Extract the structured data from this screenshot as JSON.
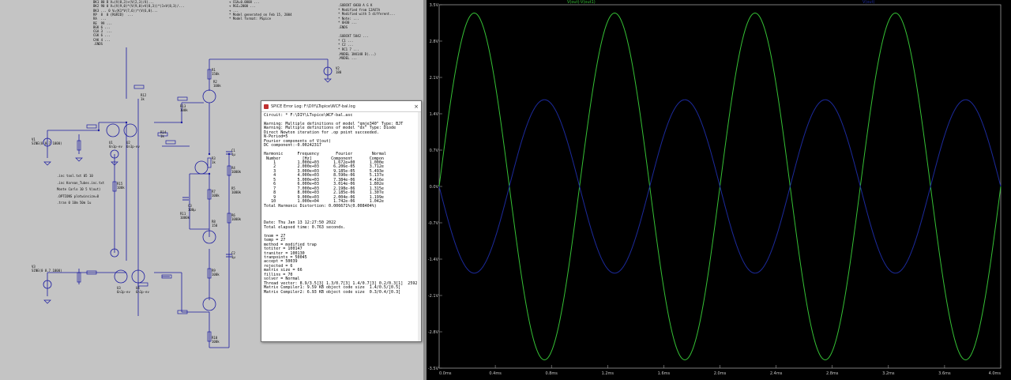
{
  "schematic": {
    "model_lines": [
      "BK1 80 B V=(V(8,3)+(V(2,3)/4)...",
      "BK2 90 0 V=(V(9,0)*(V(9,0)+V(8,3))*(1+V(8,3)/...",
      "BK3 ... 0 V=(K1*V(7,6))*(V(6,0)... ",
      "RP  8  0 {RGRID}  ...",
      "RA  ... ",
      "RE  99 ...",
      "BGK 6 ... ",
      "CGA 3  ... ",
      "CGK 6 ...",
      "CAK 4 ...",
      ".ENDS"
    ],
    "dir_lines": [
      ".inc tool.txt 05 10",
      ".inc Korean_Tubes.inc.txt",
      "Monte Carlo 10 5 V(out)",
      ".OPTIONS plotwinsize=0",
      ".tran 0 10m 50m 1u"
    ],
    "right_lines": [
      ".SUBCKT 6H30 A G K",
      "* Modified from 12AX7A",
      "* Modified with 5 different...",
      "* Note: ...",
      "* 6H30 ...",
      ".ENDS",
      "",
      ".SUBCKT 5842 ...",
      "* C1 ...",
      "* C2 ...",
      "* RC1 7 ...",
      ".MODEL 1N4148 D(...)",
      ".MODEL ..."
    ],
    "top_lines": [
      "+ CGA=0.0008 ...",
      "+ RGI=2000 ...",
      "+ ...",
      "* Model generated on Feb 15, 2004",
      "* Model format: PSpice"
    ],
    "components": [
      {
        "ref": "V2",
        "val": "180"
      },
      {
        "ref": "R1",
        "val": "150k"
      },
      {
        "ref": "R2",
        "val": "100k"
      },
      {
        "ref": "R3",
        "val": "1k"
      },
      {
        "ref": "R4",
        "val": "1000k"
      },
      {
        "ref": "R5",
        "val": "1000k"
      },
      {
        "ref": "R6",
        "val": "1000k"
      },
      {
        "ref": "R7",
        "val": "100k"
      },
      {
        "ref": "R8",
        "val": "150"
      },
      {
        "ref": "R9",
        "val": "100k"
      },
      {
        "ref": "R10",
        "val": "100k"
      },
      {
        "ref": "R11",
        "val": "1000k"
      },
      {
        "ref": "R12",
        "val": "1k"
      },
      {
        "ref": "R13",
        "val": "100k"
      },
      {
        "ref": "R14",
        "val": "1k"
      },
      {
        "ref": "R15",
        "val": "100k"
      },
      {
        "ref": "C1",
        "val": "1µ"
      },
      {
        "ref": "C2",
        "val": "1µ"
      },
      {
        "ref": "C3",
        "val": "100µ"
      },
      {
        "ref": "U1",
        "val": "6n1p-ev"
      },
      {
        "ref": "U2",
        "val": "6n1p-ev"
      },
      {
        "ref": "U3",
        "val": "6n1p-ev"
      },
      {
        "ref": "U4",
        "val": "6n1p-ev"
      },
      {
        "ref": "V1",
        "val": "SINE(0 0.7 1000)"
      },
      {
        "ref": "V3",
        "val": "SINE(0 0.7 1000)"
      }
    ]
  },
  "error_log": {
    "title": "SPICE Error Log: F:\\DIY\\LTspice\\WCF-bal.log",
    "close": "×",
    "lines": [
      "Circuit: * F:\\DIY\\LTspice\\WCF-bal.asc",
      "",
      "Warning: Multiple definitions of model \"qmje340\" Type: BJT",
      "Warning: Multiple definitions of model \"dx\" Type: Diode",
      "Direct Newton iteration for .op point succeeded.",
      "N-Period=5",
      "Fourier components of V(out)",
      "DC component:-0.00242317",
      "",
      "Harmonic      Frequency       Fourier        Normal",
      " Number         [Hz]        Component       Compon",
      "    1         1.000e+03      1.672e+00      1.000e",
      "    2         2.000e+03      6.206e-05      3.712e",
      "    3         3.000e+03      9.185e-05      5.493e",
      "    4         4.000e+03      8.590e-06      5.137e",
      "    5         5.000e+03      7.384e-06      4.416e",
      "    6         6.000e+03      3.014e-06      1.802e",
      "    7         7.000e+03      2.198e-06      1.315e",
      "    8         8.000e+03      2.185e-06      1.307e",
      "    9         9.000e+03      2.004e-06      1.199e",
      "   10         1.000e+04      1.742e-06      1.042e",
      "Total Harmonic Distortion: 0.006671%(0.008404%)",
      "",
      "",
      "",
      "Date: Thu Jan 13 12:27:50 2022",
      "Total elapsed time: 0.763 seconds.",
      "",
      "tnom = 27",
      "temp = 27",
      "method = modified trap",
      "totiter = 100147",
      "traniter = 100130",
      "tranpoints = 50045",
      "accept = 50039",
      "rejected = 6",
      "matrix size = 66",
      "fillins = 70",
      "solver = Normal",
      "Thread vector: 8.9/3.5[3] 1.3/0.7[3] 1.4/0.7[3] 0.2/0.3[1]  2592",
      "Matrix Compiler1: 9.59 KB object code size  1.4/0.5/[0.5]",
      "Matrix Compiler2: 6.93 KB object code size  0.3/0.4/[0.3]"
    ]
  },
  "plot": {
    "trace_green_label": "V(out)-V(out1)",
    "trace_blue_label": "V(out)",
    "colors": {
      "green": "#35c035",
      "blue": "#1c2a9c",
      "grid": "#9a9a9a",
      "bg": "#000000"
    },
    "y_ticks": [
      "3.5V",
      "2.8V",
      "2.1V",
      "1.4V",
      "0.7V",
      "0.0V",
      "-0.7V",
      "-1.4V",
      "-2.1V",
      "-2.8V",
      "-3.5V"
    ],
    "x_ticks": [
      "0.0ms",
      "0.4ms",
      "0.8ms",
      "1.2ms",
      "1.6ms",
      "2.0ms",
      "2.4ms",
      "2.8ms",
      "3.2ms",
      "3.6ms",
      "4.0ms"
    ],
    "series": [
      {
        "name": "V(out)-V(out1)",
        "amplitude_v": 3.34,
        "freq_hz": 1000,
        "phase": "sin"
      },
      {
        "name": "V(out)",
        "amplitude_v": 1.67,
        "freq_hz": 1000,
        "phase": "-sin"
      }
    ],
    "x_range_ms": [
      0,
      4
    ],
    "y_range_v": [
      -3.5,
      3.5
    ]
  }
}
